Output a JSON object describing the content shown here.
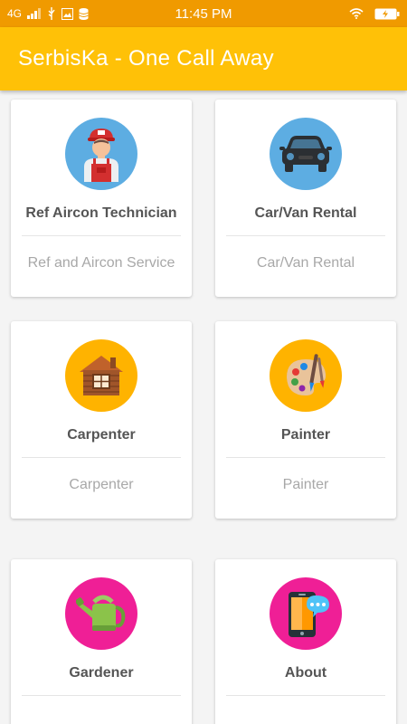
{
  "status_bar": {
    "network": "4G",
    "time": "11:45 PM"
  },
  "app": {
    "title": "SerbisKa - One Call Away"
  },
  "colors": {
    "status_bar": "#f09a00",
    "toolbar": "#ffc107",
    "blue_circle": "#5dade2",
    "yellow_circle": "#ffb300",
    "pink_circle": "#ef1f96"
  },
  "services": [
    {
      "title": "Ref Aircon Technician",
      "subtitle": "Ref and Aircon Service",
      "icon": "technician-icon"
    },
    {
      "title": "Car/Van Rental",
      "subtitle": "Car/Van Rental",
      "icon": "car-icon"
    },
    {
      "title": "Carpenter",
      "subtitle": "Carpenter",
      "icon": "house-icon"
    },
    {
      "title": "Painter",
      "subtitle": "Painter",
      "icon": "palette-icon"
    },
    {
      "title": "Gardener",
      "subtitle": "",
      "icon": "watering-can-icon"
    },
    {
      "title": "About",
      "subtitle": "",
      "icon": "phone-chat-icon"
    }
  ]
}
